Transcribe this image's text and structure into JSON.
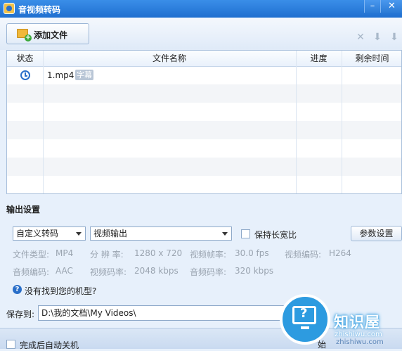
{
  "window": {
    "title": "音视频转码"
  },
  "toolbar": {
    "add_file_label": "添加文件"
  },
  "table": {
    "columns": [
      "状态",
      "文件名称",
      "进度",
      "剩余时间"
    ],
    "rows": [
      {
        "filename": "1.mp4",
        "badge": "字幕"
      }
    ]
  },
  "output": {
    "section_title": "输出设置",
    "preset": "自定义转码",
    "format": "视频输出",
    "keep_ratio_label": "保持长宽比",
    "params_button": "参数设置",
    "file_type_label": "文件类型:",
    "file_type": "MP4",
    "resolution_label": "分 辨 率:",
    "resolution": "1280 x 720",
    "framerate_label": "视频帧率:",
    "framerate": "30.0 fps",
    "video_codec_label": "视频编码:",
    "video_codec": "H264",
    "audio_codec_label": "音频编码:",
    "audio_codec": "AAC",
    "video_bitrate_label": "视频码率:",
    "video_bitrate": "2048 kbps",
    "audio_bitrate_label": "音频码率:",
    "audio_bitrate": "320 kbps",
    "help_text": "没有找到您的机型?"
  },
  "save": {
    "label": "保存到:",
    "path": "D:\\我的文档\\My Videos\\"
  },
  "bottom": {
    "auto_shutdown_label": "完成后自动关机",
    "start_partial": "始"
  },
  "watermark": {
    "brand": "知识屋",
    "domain": "zhishiwu.com",
    "url_partial": "zhishiwu.com"
  }
}
